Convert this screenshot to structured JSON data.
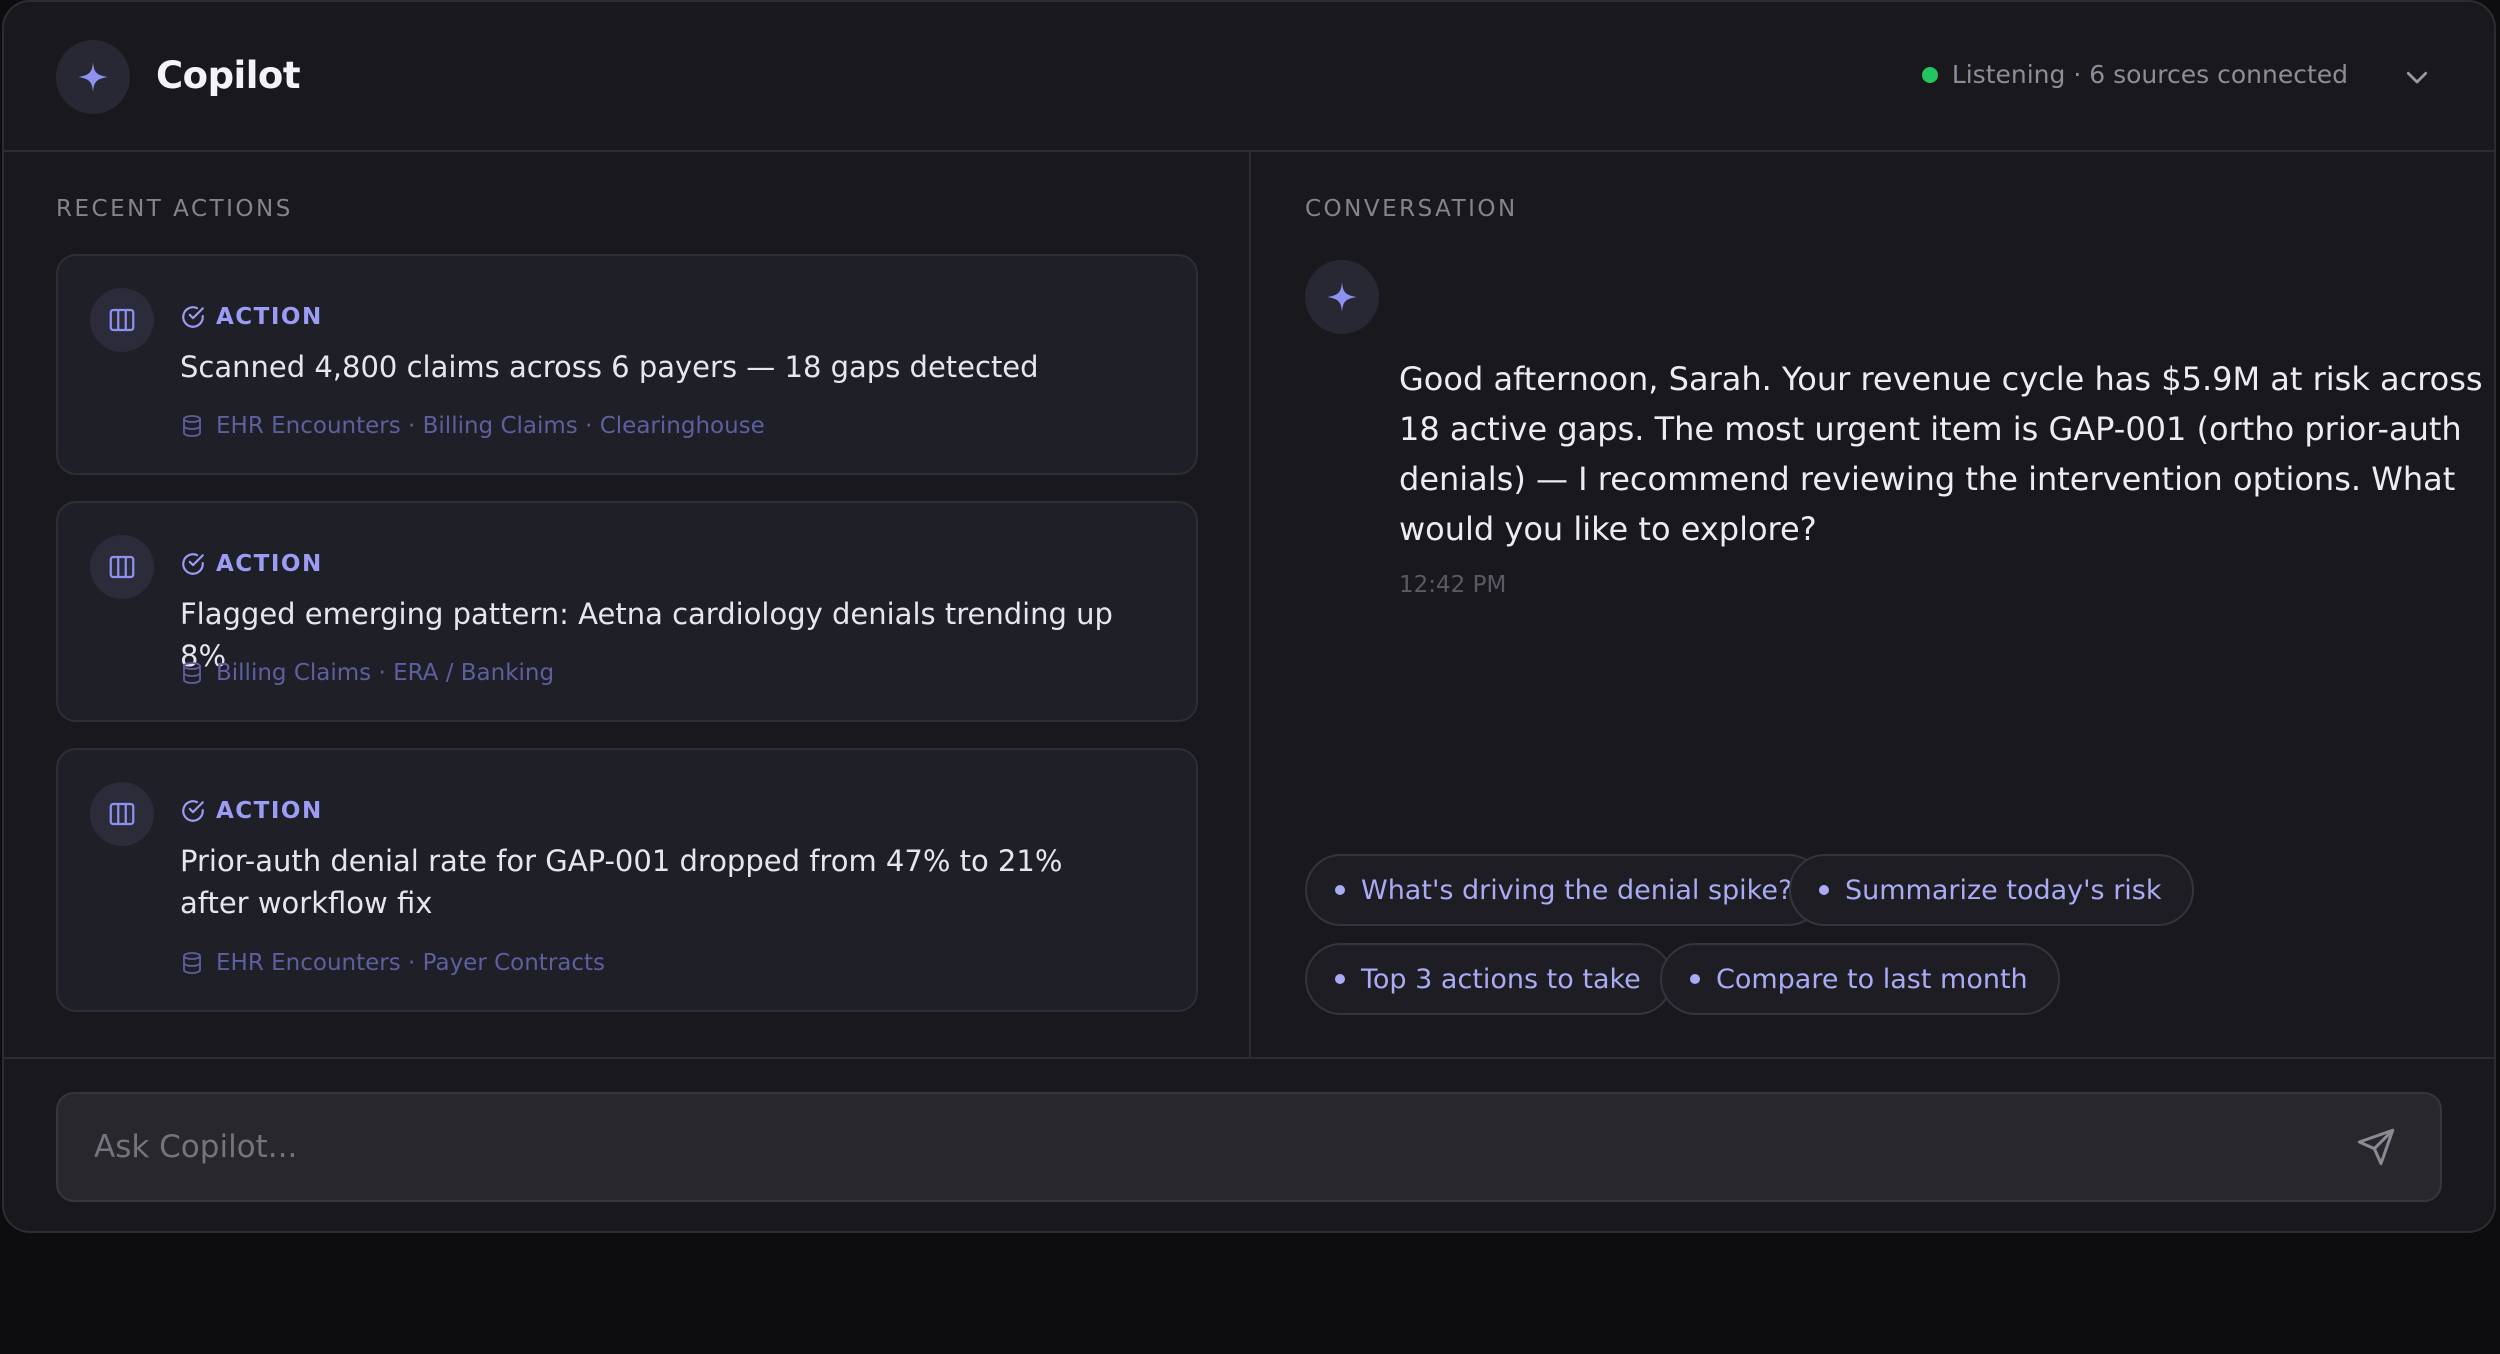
{
  "header": {
    "title": "Copilot",
    "status": "Listening · 6 sources connected",
    "status_color": "#22c55e"
  },
  "recent_actions": {
    "label": "RECENT ACTIONS",
    "items": [
      {
        "tag": "ACTION",
        "text": "Scanned 4,800 claims across 6 payers — 18 gaps detected",
        "sources": "EHR Encounters · Billing Claims · Clearinghouse"
      },
      {
        "tag": "ACTION",
        "text": "Flagged emerging pattern: Aetna cardiology denials trending up 8%",
        "sources": "Billing Claims · ERA / Banking"
      },
      {
        "tag": "ACTION",
        "text": "Prior-auth denial rate for GAP-001 dropped from 47% to 21% after workflow fix",
        "sources": "EHR Encounters · Payer Contracts"
      }
    ]
  },
  "conversation": {
    "label": "CONVERSATION",
    "message": "Good afternoon, Sarah. Your revenue cycle has $5.9M at risk across 18 active gaps. The most urgent item is GAP-001 (ortho prior-auth denials) — I recommend reviewing the intervention options. What would you like to explore?",
    "time": "12:42 PM",
    "suggestions": [
      "What's driving the denial spike?",
      "Summarize today's risk",
      "Top 3 actions to take",
      "Compare to last month"
    ]
  },
  "input": {
    "placeholder": "Ask Copilot..."
  },
  "colors": {
    "accent": "#9a9cf5",
    "background": "#19191d",
    "card": "#1f1f27"
  }
}
